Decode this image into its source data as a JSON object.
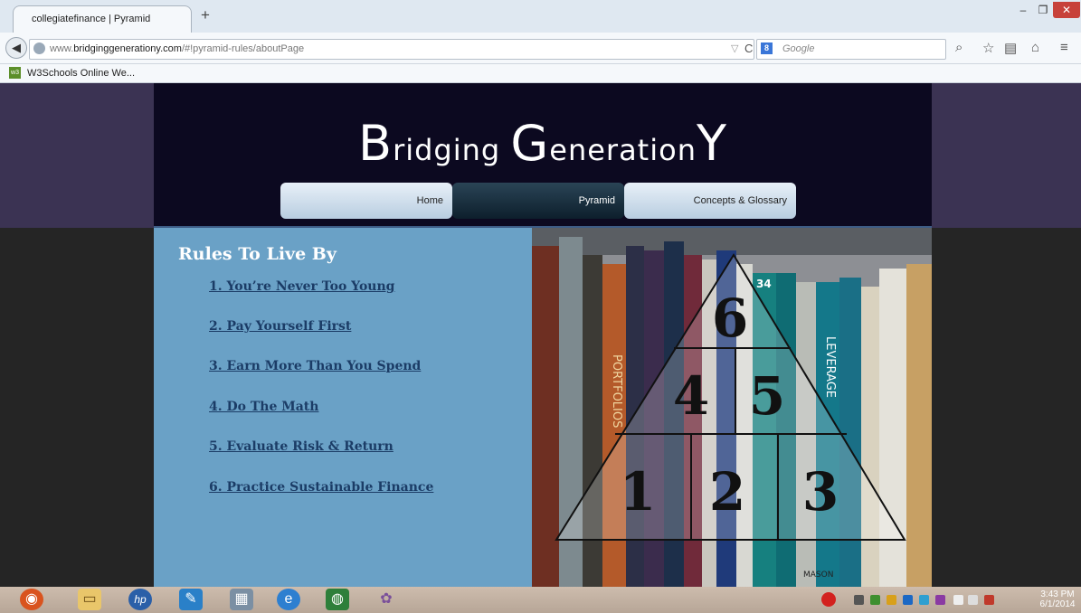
{
  "browser": {
    "tab_title": "collegiatefinance | Pyramid",
    "new_tab": "+",
    "url_prefix": "www.",
    "url_domain": "bridginggenerationy.com",
    "url_path": "/#!pyramid-rules/aboutPage",
    "url_controls": "▽",
    "reload": "C",
    "search_engine": "8",
    "search_placeholder": "Google",
    "bookmark_label": "W3Schools Online We..."
  },
  "site": {
    "title_parts": {
      "b_big": "B",
      "b_rest": "ridging ",
      "g_big": "G",
      "g_rest": "eneration",
      "y_big": "Y"
    },
    "nav": [
      "Home",
      "Pyramid",
      "Concepts & Glossary"
    ],
    "rules_heading": "Rules To Live By",
    "rules": [
      "1. You’re Never Too Young",
      "2. Pay Yourself First",
      "3. Earn More Than You Spend",
      "4. Do The Math",
      "5. Evaluate Risk & Return",
      "6. Practice Sustainable Finance"
    ],
    "pyramid_numbers": [
      "1",
      "2",
      "3",
      "4",
      "5",
      "6"
    ],
    "book_labels": [
      "PORTFOLIOS",
      "LEVERAGE",
      "34",
      "MASON"
    ]
  },
  "taskbar": {
    "time": "3:43 PM",
    "date": "6/1/2014"
  },
  "colors": {
    "header_bg": "#0c0920",
    "rules_bg": "#6aa1c6",
    "rule_link": "#1b3c66",
    "side_top": "#3b3353"
  }
}
